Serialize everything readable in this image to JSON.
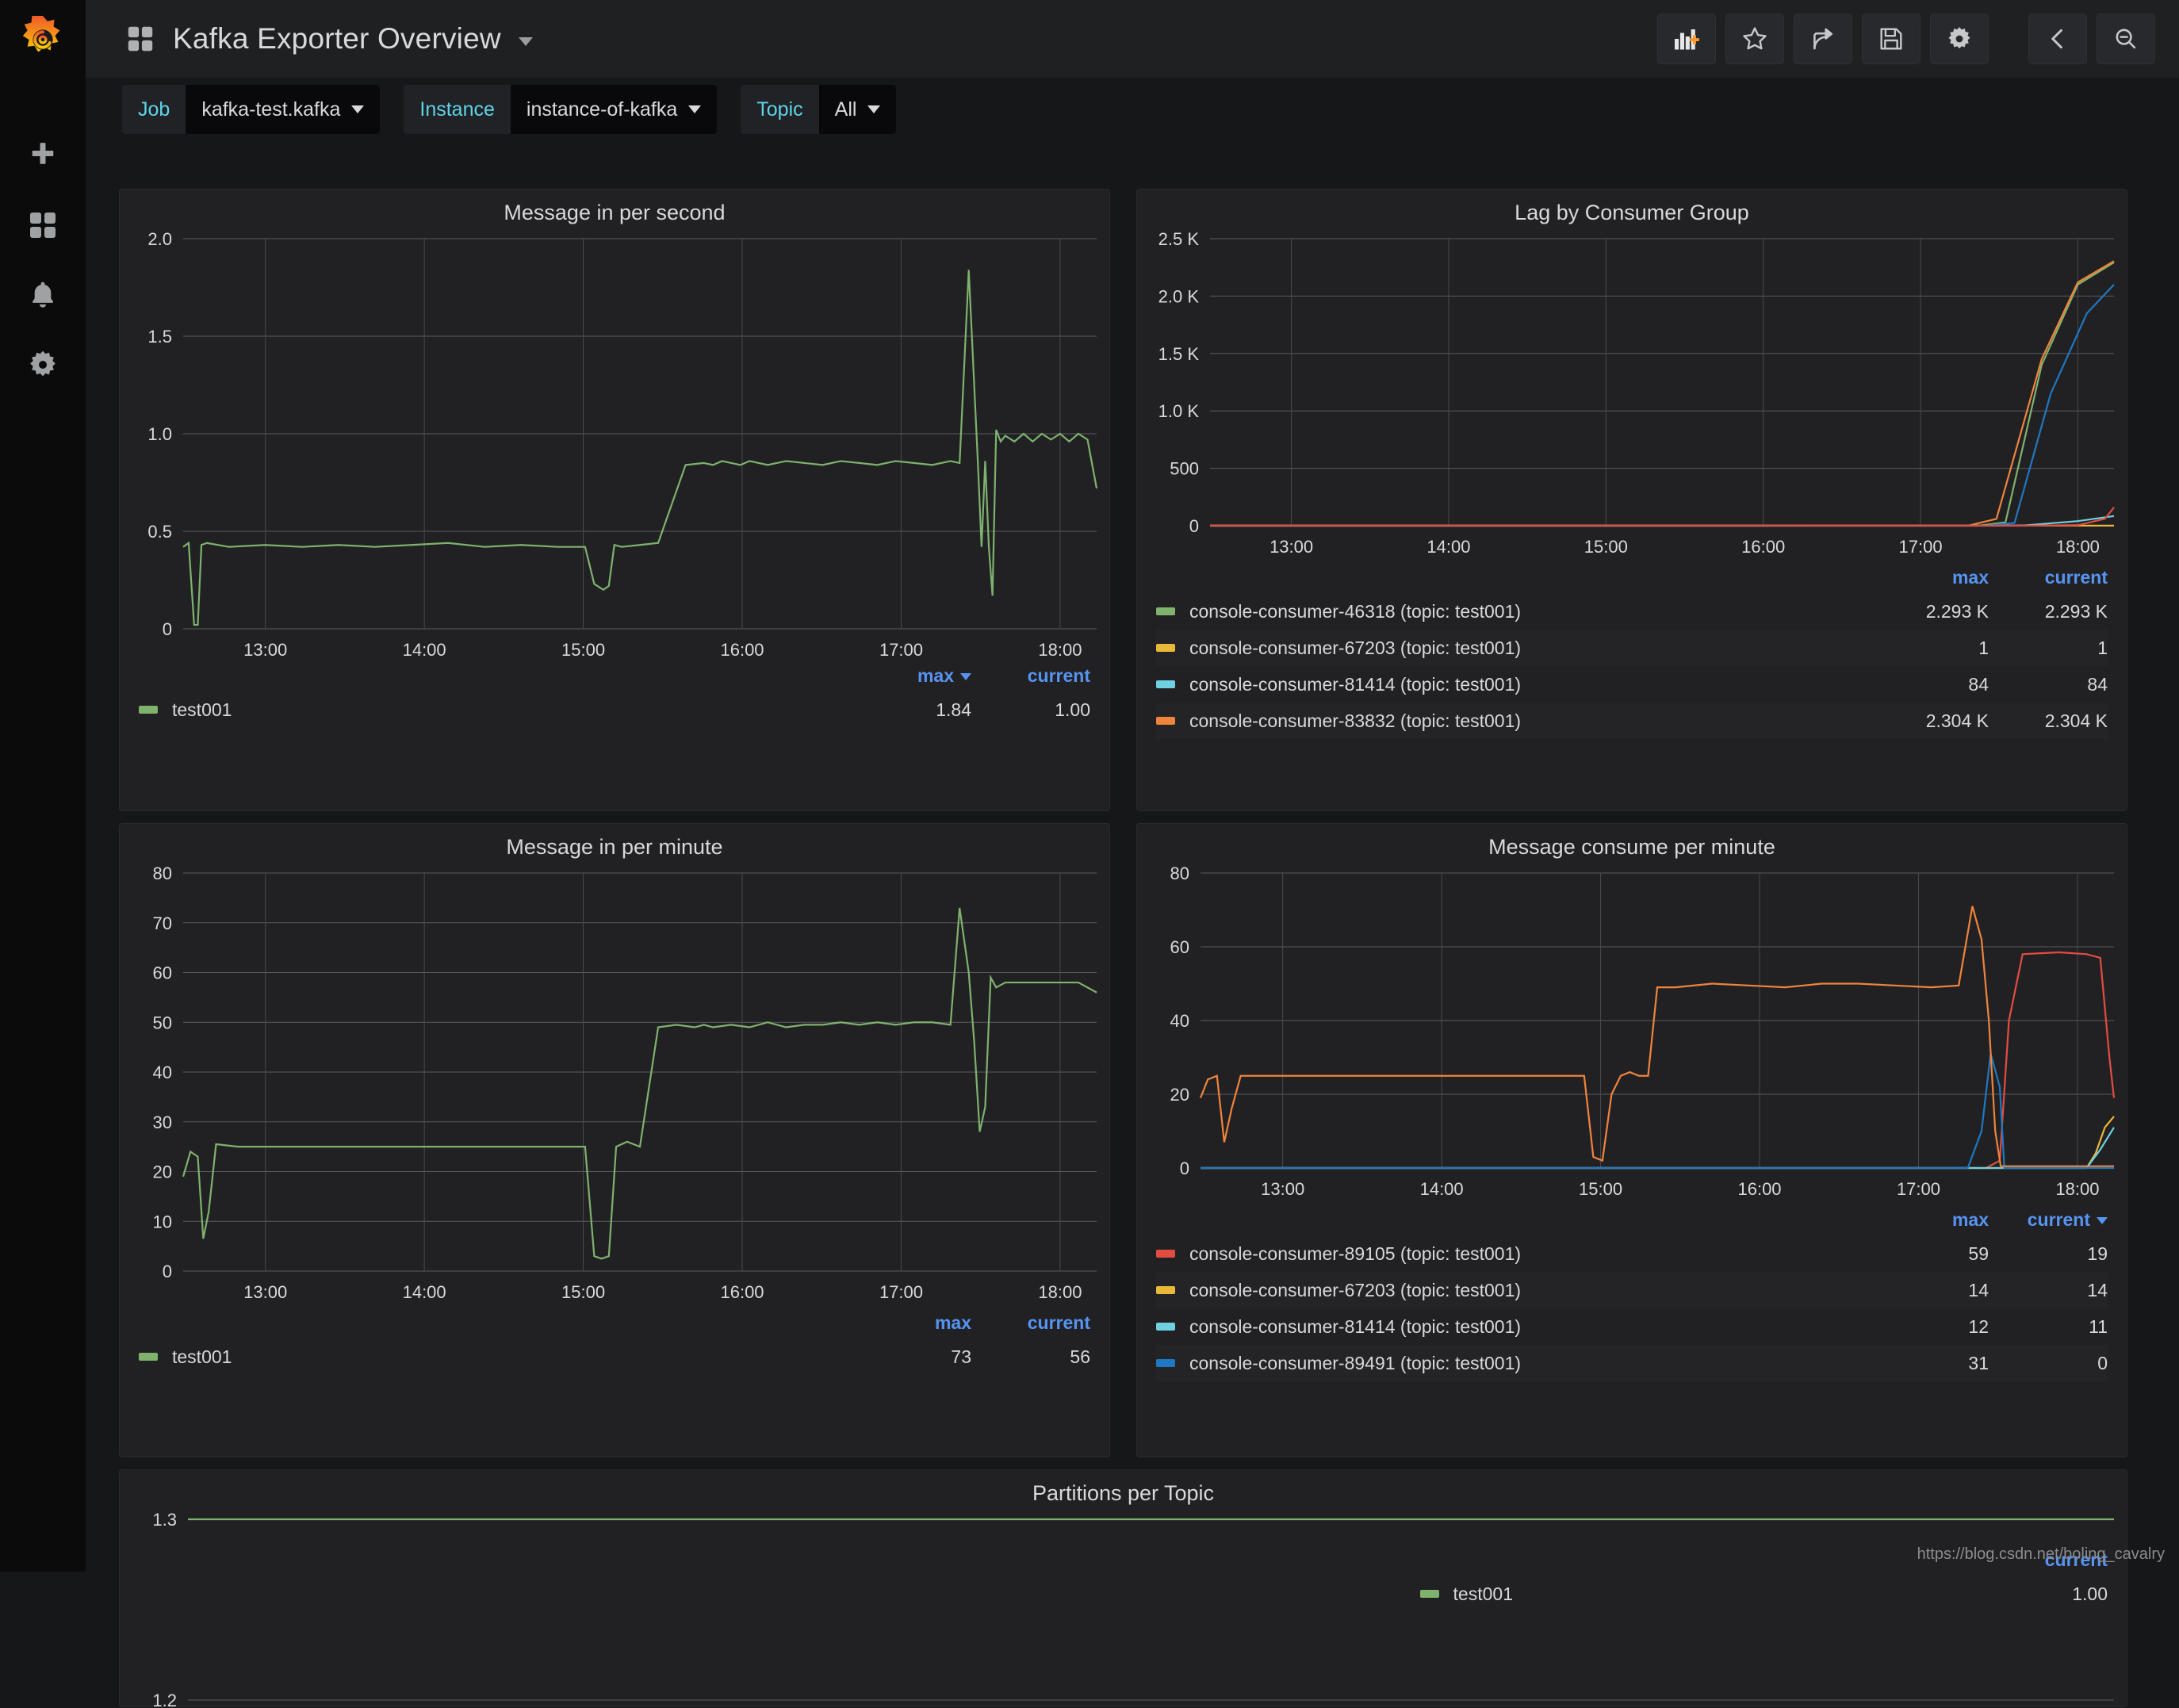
{
  "app": {
    "brand_icon": "grafana-logo-icon",
    "title": "Kafka Exporter Overview",
    "title_caret": "chevron-down-icon",
    "dashboard_icon": "dashboard-grid-icon",
    "watermark": "https://blog.csdn.net/boling_cavalry"
  },
  "sidebar": {
    "items": [
      {
        "name": "create-icon",
        "label": "Create"
      },
      {
        "name": "dashboards-icon",
        "label": "Dashboards"
      },
      {
        "name": "alerting-bell-icon",
        "label": "Alerting"
      },
      {
        "name": "configuration-gear-icon",
        "label": "Configuration"
      }
    ]
  },
  "toolbar": {
    "buttons": [
      {
        "name": "add-panel-button",
        "icon": "add-panel-icon",
        "label": "Add panel"
      },
      {
        "name": "star-button",
        "icon": "star-icon",
        "label": "Mark as favorite"
      },
      {
        "name": "share-button",
        "icon": "share-icon",
        "label": "Share dashboard"
      },
      {
        "name": "save-button",
        "icon": "save-floppy-icon",
        "label": "Save dashboard"
      },
      {
        "name": "settings-button",
        "icon": "gear-icon",
        "label": "Dashboard settings"
      },
      {
        "name": "collapse-button",
        "icon": "chevron-left-icon",
        "label": "Collapse"
      },
      {
        "name": "zoom-out-button",
        "icon": "zoom-out-icon",
        "label": "Zoom out time range"
      }
    ]
  },
  "variables": [
    {
      "name": "job",
      "label": "Job",
      "value": "kafka-test.kafka",
      "caret": "chevron-down-icon"
    },
    {
      "name": "instance",
      "label": "Instance",
      "value": "instance-of-kafka",
      "caret": "chevron-down-icon"
    },
    {
      "name": "topic",
      "label": "Topic",
      "value": "All",
      "caret": "chevron-down-icon"
    }
  ],
  "colors": {
    "green": "#7eb26d",
    "yellow": "#eab839",
    "light_blue": "#6ed0e0",
    "orange": "#ef843c",
    "red": "#e24d42",
    "blue": "#1f78c1",
    "accent_blue": "#5794f2",
    "panel_bg": "#212124",
    "page_bg": "#161719"
  },
  "chart_data": [
    {
      "id": "message-in-per-second",
      "type": "line",
      "title": "Message in per second",
      "xlabel": "",
      "ylabel": "",
      "grid": true,
      "legend_position": "bottom-table",
      "xlim": [
        "12:30",
        "18:05"
      ],
      "xticks": [
        "13:00",
        "14:00",
        "15:00",
        "16:00",
        "17:00",
        "18:00"
      ],
      "ylim": [
        0,
        2.0
      ],
      "yticks": [
        "0",
        "0.5",
        "1.0",
        "1.5",
        "2.0"
      ],
      "legend_columns": [
        "max",
        "current"
      ],
      "sorted_by": "max",
      "series": [
        {
          "name": "test001",
          "color": "#7eb26d",
          "max": "1.84",
          "current": "1.00",
          "x": [
            0,
            0.6,
            1.2,
            1.6,
            2.0,
            2.6,
            5,
            9,
            13,
            17,
            21,
            25,
            29,
            33,
            37,
            41,
            44,
            45,
            46,
            46.6,
            47.2,
            48,
            50,
            52,
            55,
            57,
            58,
            59,
            60,
            61,
            62,
            63,
            64,
            66,
            68,
            70,
            72,
            74,
            76,
            78,
            80,
            82,
            84,
            85,
            86,
            87,
            87.4,
            87.8,
            88.2,
            88.6,
            89,
            89.5,
            90,
            91,
            92,
            93,
            94,
            95,
            96,
            97,
            98,
            99,
            100
          ],
          "y": [
            0.42,
            0.44,
            0.02,
            0.02,
            0.43,
            0.44,
            0.42,
            0.43,
            0.42,
            0.43,
            0.42,
            0.43,
            0.44,
            0.42,
            0.43,
            0.42,
            0.42,
            0.23,
            0.2,
            0.22,
            0.43,
            0.42,
            0.43,
            0.44,
            0.84,
            0.85,
            0.84,
            0.86,
            0.85,
            0.84,
            0.86,
            0.85,
            0.84,
            0.86,
            0.85,
            0.84,
            0.86,
            0.85,
            0.84,
            0.86,
            0.85,
            0.84,
            0.86,
            0.85,
            1.84,
            0.85,
            0.42,
            0.86,
            0.42,
            0.17,
            1.02,
            0.96,
            0.99,
            0.96,
            1.0,
            0.96,
            1.0,
            0.97,
            1.0,
            0.96,
            1.0,
            0.97,
            0.72
          ]
        }
      ]
    },
    {
      "id": "lag-by-consumer-group",
      "type": "line",
      "title": "Lag by Consumer Group",
      "xlabel": "",
      "ylabel": "",
      "grid": true,
      "legend_position": "bottom-table",
      "xlim": [
        "12:30",
        "18:05"
      ],
      "xticks": [
        "13:00",
        "14:00",
        "15:00",
        "16:00",
        "17:00",
        "18:00"
      ],
      "ylim": [
        0,
        2500
      ],
      "yticks": [
        "0",
        "500",
        "1.0 K",
        "1.5 K",
        "2.0 K",
        "2.5 K"
      ],
      "legend_columns": [
        "max",
        "current"
      ],
      "series": [
        {
          "name": "console-consumer-46318 (topic: test001)",
          "color": "#7eb26d",
          "max": "2.293 K",
          "current": "2.293 K",
          "x": [
            0,
            60,
            85,
            88,
            92,
            96,
            100
          ],
          "y": [
            0,
            0,
            0,
            30,
            1400,
            2100,
            2293
          ]
        },
        {
          "name": "console-consumer-67203 (topic: test001)",
          "color": "#eab839",
          "max": "1",
          "current": "1",
          "x": [
            0,
            50,
            100
          ],
          "y": [
            1,
            1,
            1
          ]
        },
        {
          "name": "console-consumer-81414 (topic: test001)",
          "color": "#6ed0e0",
          "max": "84",
          "current": "84",
          "x": [
            0,
            60,
            90,
            96,
            100
          ],
          "y": [
            0,
            0,
            2,
            40,
            84
          ]
        },
        {
          "name": "console-consumer-83832 (topic: test001)",
          "color": "#ef843c",
          "max": "2.304 K",
          "current": "2.304 K",
          "x": [
            0,
            60,
            84,
            87,
            92,
            96,
            100
          ],
          "y": [
            2,
            2,
            3,
            60,
            1450,
            2120,
            2304
          ]
        }
      ],
      "extra_series": [
        {
          "name": "blue-line",
          "color": "#1f78c1",
          "x": [
            0,
            86,
            89,
            93,
            97,
            100
          ],
          "y": [
            0,
            0,
            25,
            1150,
            1850,
            2100
          ]
        },
        {
          "name": "red-line",
          "color": "#e24d42",
          "x": [
            0,
            90,
            96,
            99,
            100
          ],
          "y": [
            0,
            0,
            5,
            60,
            160
          ]
        }
      ]
    },
    {
      "id": "message-in-per-minute",
      "type": "line",
      "title": "Message in per minute",
      "xlabel": "",
      "ylabel": "",
      "grid": true,
      "legend_position": "bottom-table",
      "xlim": [
        "12:30",
        "18:05"
      ],
      "xticks": [
        "13:00",
        "14:00",
        "15:00",
        "16:00",
        "17:00",
        "18:00"
      ],
      "ylim": [
        0,
        80
      ],
      "yticks": [
        "0",
        "10",
        "20",
        "30",
        "40",
        "50",
        "60",
        "70",
        "80"
      ],
      "legend_columns": [
        "max",
        "current"
      ],
      "series": [
        {
          "name": "test001",
          "color": "#7eb26d",
          "max": "73",
          "current": "56",
          "x": [
            0,
            0.8,
            1.6,
            2.2,
            2.8,
            3.6,
            6,
            10,
            14,
            18,
            22,
            26,
            30,
            34,
            38,
            42,
            44,
            45,
            45.8,
            46.6,
            47.4,
            48.6,
            50,
            52,
            54,
            56,
            57,
            58,
            60,
            62,
            64,
            66,
            68,
            70,
            72,
            74,
            76,
            78,
            80,
            82,
            84,
            85,
            86,
            86.6,
            87.2,
            87.8,
            88.4,
            89,
            90,
            92,
            94,
            96,
            98,
            100
          ],
          "y": [
            19,
            24,
            23,
            6.5,
            12,
            25.5,
            25,
            25,
            25,
            25,
            25,
            25,
            25,
            25,
            25,
            25,
            25,
            3,
            2.5,
            3,
            25,
            26,
            25,
            49,
            49.5,
            49,
            49.5,
            49,
            49.5,
            49,
            50,
            49,
            49.5,
            49.5,
            50,
            49.5,
            50,
            49.5,
            50,
            50,
            49.5,
            73,
            60,
            46,
            28,
            33,
            59,
            57,
            58,
            58,
            58,
            58,
            58,
            56
          ]
        }
      ]
    },
    {
      "id": "message-consume-per-minute",
      "type": "line",
      "title": "Message consume per minute",
      "xlabel": "",
      "ylabel": "",
      "grid": true,
      "legend_position": "bottom-table",
      "xlim": [
        "12:30",
        "18:05"
      ],
      "xticks": [
        "13:00",
        "14:00",
        "15:00",
        "16:00",
        "17:00",
        "18:00"
      ],
      "ylim": [
        0,
        80
      ],
      "yticks": [
        "0",
        "20",
        "40",
        "60",
        "80"
      ],
      "legend_columns": [
        "max",
        "current"
      ],
      "sorted_by": "current",
      "series": [
        {
          "name": "console-consumer-89105 (topic: test001)",
          "color": "#e24d42",
          "max": "59",
          "current": "19",
          "x": [
            0,
            86,
            87.5,
            88.5,
            90,
            94,
            97,
            98.5,
            99.5,
            100
          ],
          "y": [
            0,
            0,
            2,
            40,
            58,
            58.5,
            58,
            57,
            30,
            19
          ]
        },
        {
          "name": "console-consumer-67203 (topic: test001)",
          "color": "#eab839",
          "max": "14",
          "current": "14",
          "x": [
            0,
            97,
            98,
            99,
            100
          ],
          "y": [
            0,
            0,
            4,
            11,
            14
          ]
        },
        {
          "name": "console-consumer-81414 (topic: test001)",
          "color": "#6ed0e0",
          "max": "12",
          "current": "11",
          "x": [
            0,
            97,
            98.5,
            100
          ],
          "y": [
            0,
            0,
            5,
            11
          ]
        },
        {
          "name": "console-consumer-89491 (topic: test001)",
          "color": "#1f78c1",
          "max": "31",
          "current": "0",
          "x": [
            0,
            84,
            85.5,
            86.5,
            87.5,
            88,
            100
          ],
          "y": [
            0,
            0,
            10,
            31,
            22,
            0,
            0
          ]
        }
      ],
      "extra_series": [
        {
          "name": "orange-line",
          "color": "#ef843c",
          "x": [
            0,
            0.8,
            1.8,
            2.6,
            3.4,
            4.4,
            8,
            12,
            16,
            20,
            24,
            28,
            32,
            36,
            40,
            42,
            43,
            44,
            45,
            46,
            47,
            48,
            49,
            50,
            52,
            56,
            60,
            64,
            68,
            72,
            76,
            80,
            83,
            84.5,
            85.5,
            86.3,
            87,
            87.6,
            100
          ],
          "y": [
            19,
            24,
            25,
            7,
            16,
            25,
            25,
            25,
            25,
            25,
            25,
            25,
            25,
            25,
            25,
            25,
            3,
            2,
            20,
            25,
            26,
            25,
            25,
            49,
            49,
            50,
            49.5,
            49,
            50,
            50,
            49.5,
            49,
            49.5,
            71,
            62,
            40,
            10,
            0.5,
            0.5
          ]
        }
      ]
    },
    {
      "id": "partitions-per-topic",
      "type": "line",
      "title": "Partitions per Topic",
      "xlabel": "",
      "ylabel": "",
      "grid": true,
      "legend_position": "bottom-table",
      "ylim": [
        1.2,
        1.3
      ],
      "yticks": [
        "1.3",
        "1.2"
      ],
      "legend_columns": [
        "current"
      ],
      "series": [
        {
          "name": "test001",
          "color": "#7eb26d",
          "current": "1.00",
          "x": [
            0,
            100
          ],
          "y": [
            1.3,
            1.3
          ]
        }
      ]
    }
  ]
}
